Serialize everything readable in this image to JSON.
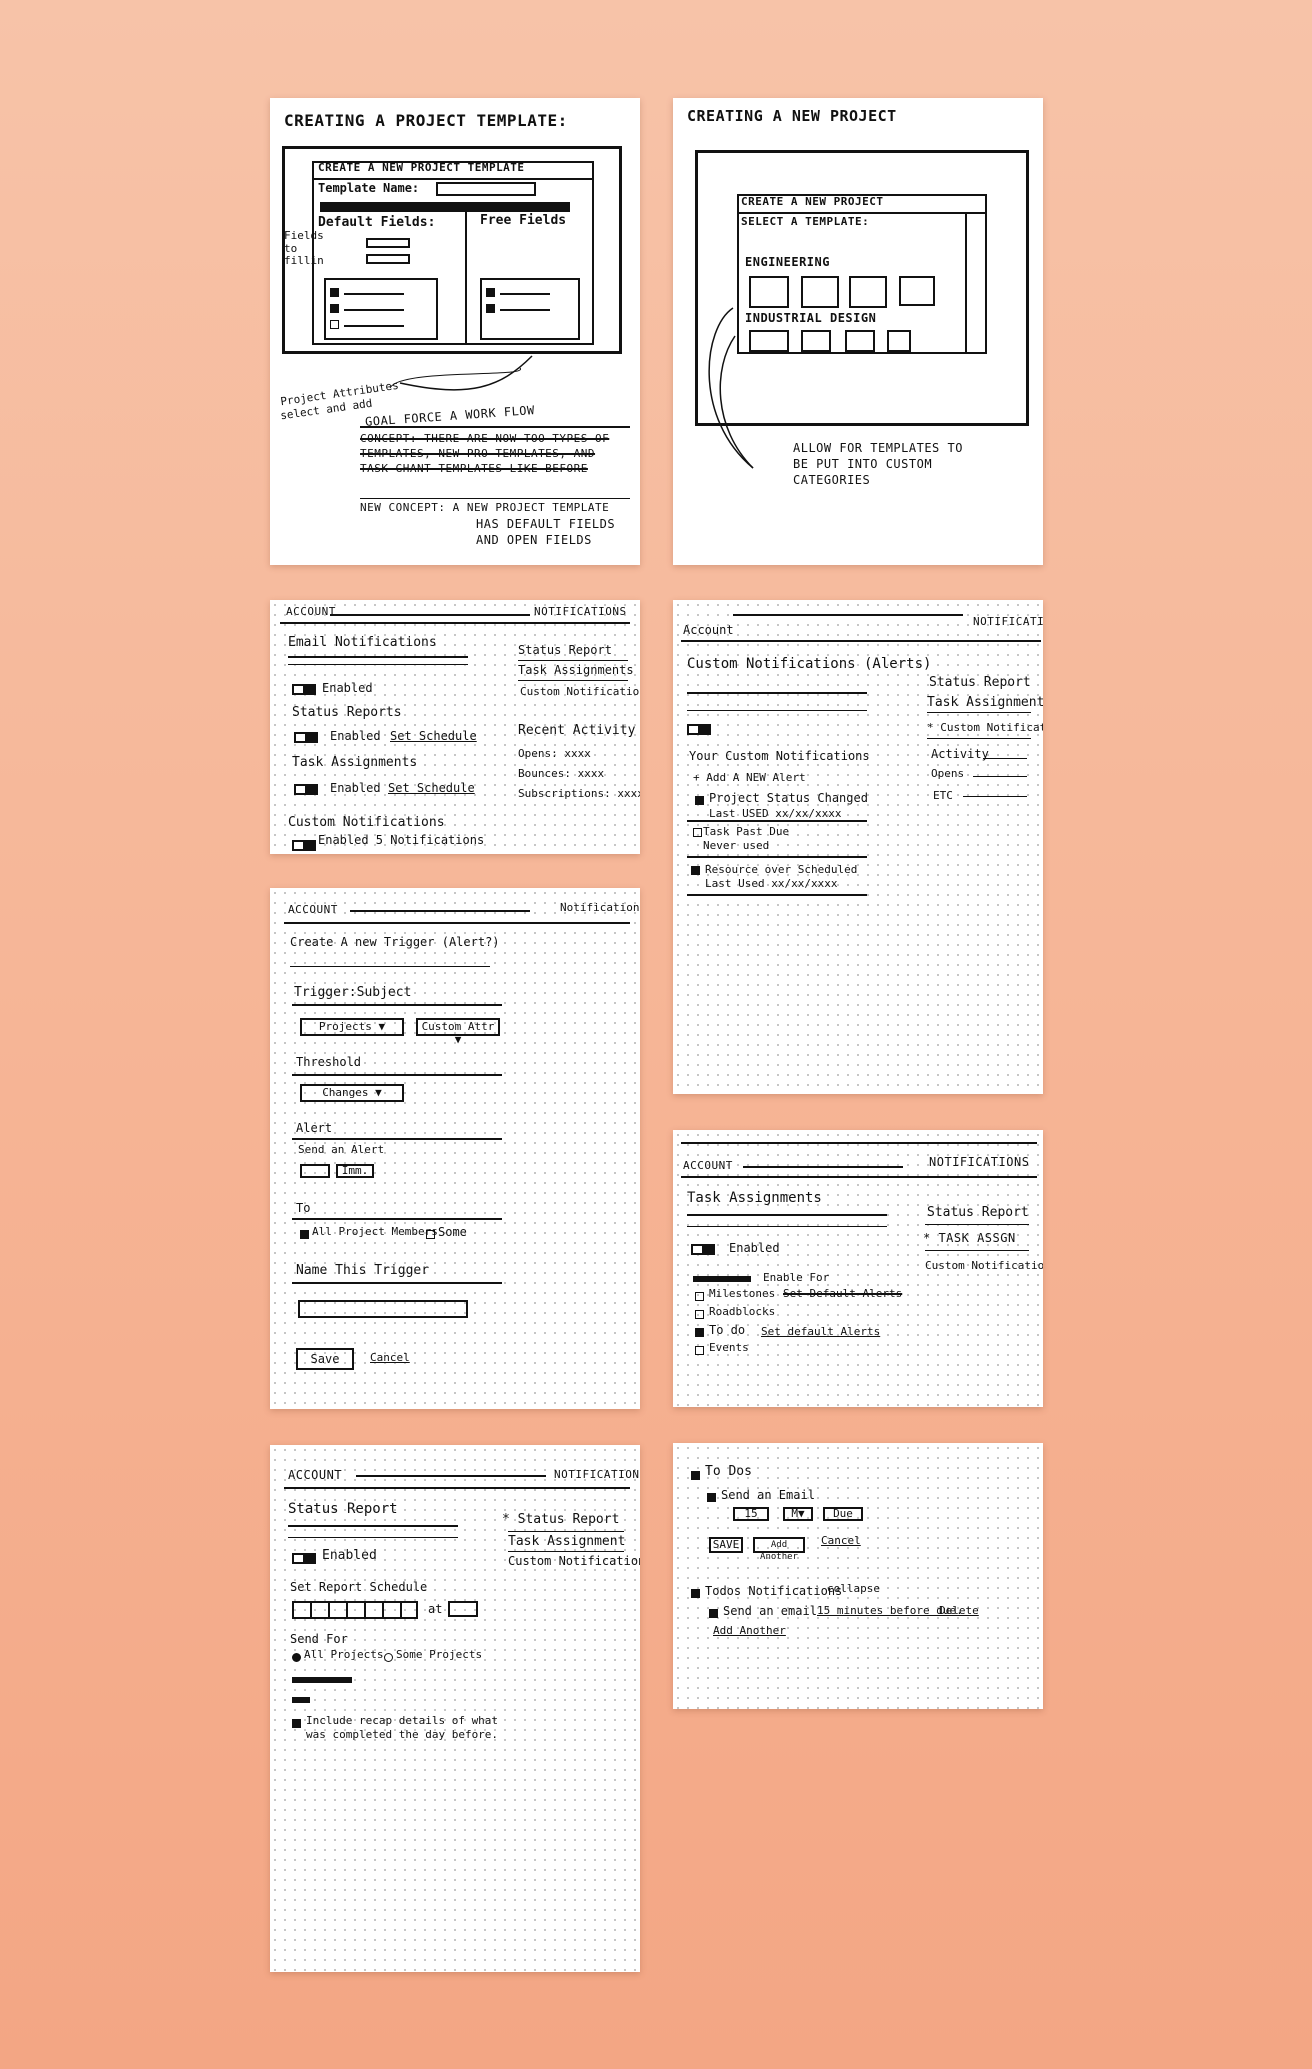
{
  "card1": {
    "title": "CREATING A PROJECT TEMPLATE:",
    "window_title": "CREATE A NEW PROJECT TEMPLATE",
    "template_name_label": "Template Name:",
    "default_fields": "Default Fields:",
    "free_fields": "Free Fields",
    "side_note": "Fields to fillin",
    "note_attributes": "Project Attributes",
    "note_select": "select and add",
    "goal": "GOAL FORCE A WORK FLOW",
    "struck": "CONCEPT: THERE ARE NOW TOO TYPES OF TEMPLATES, NEW PRO TEMPLATES, AND TASK GHANT TEMPLATES LIKE BEFORE",
    "new_concept_1": "NEW CONCEPT: A NEW PROJECT TEMPLATE",
    "new_concept_2": "HAS DEFAULT FIELDS",
    "new_concept_3": "AND OPEN FIELDS"
  },
  "card2": {
    "title": "CREATING A NEW PROJECT",
    "window_title": "CREATE A NEW PROJECT",
    "select_label": "SELECT A TEMPLATE:",
    "category_1": "ENGINEERING",
    "category_2": "INDUSTRIAL DESIGN",
    "note_1": "ALLOW FOR TEMPLATES TO",
    "note_2": "BE PUT INTO CUSTOM",
    "note_3": "CATEGORIES"
  },
  "card3": {
    "account": "ACCOUNT",
    "notifications": "NOTIFICATIONS",
    "email_notifications": "Email Notifications",
    "enabled": "Enabled",
    "status_reports": "Status Reports",
    "set_schedule": "Set Schedule",
    "task_assignments": "Task Assignments",
    "custom_notifications": "Custom Notifications",
    "enabled_5": "Enabled  5 Notifications",
    "nav": [
      "Status Report",
      "Task Assignments",
      "Custom Notification"
    ],
    "recent_activity": "Recent Activity",
    "opens": "Opens: xxxx",
    "bounces": "Bounces: xxxx",
    "subscriptions": "Subscriptions: xxxx"
  },
  "card4": {
    "account": "Account",
    "notifications": "NOTIFICATI",
    "title": "Custom Notifications (Alerts)",
    "subtitle": "(Alerts)",
    "your_custom": "Your Custom Notifications",
    "add": "+ Add A NEW Alert",
    "item1": "Project Status Changed",
    "item1_meta": "Last USED xx/xx/xxxx",
    "item2": "Task Past Due",
    "item2_meta": "Never used",
    "item3": "Resource over Scheduled",
    "item3_meta": "Last Used xx/xx/xxxx",
    "nav": [
      "Status Report",
      "Task Assignment",
      "* Custom Notification"
    ],
    "activity": "Activity",
    "opens": "Opens",
    "etc": "ETC"
  },
  "card5": {
    "account": "ACCOUNT",
    "notifications": "Notifications",
    "title": "Create A new Trigger (Alert?)",
    "trigger_subject": "Trigger:Subject",
    "projects": "Projects",
    "custom_attr": "Custom Attr",
    "threshold": "Threshold",
    "changes": "Changes",
    "alert": "Alert",
    "send_alert": "Send an Alert",
    "immed": "Imm.",
    "to": "To",
    "all_members": "All Project Members",
    "some": "Some",
    "name_trigger": "Name This Trigger",
    "save": "Save",
    "cancel": "Cancel"
  },
  "card6": {
    "account": "ACCOUNT",
    "notifications": "NOTIFICATIONS",
    "title": "Task Assignments",
    "enabled": "Enabled",
    "enable_for": "Enable For",
    "milestones": "Milestones",
    "set_default_alerts_struck": "Set Default Alerts",
    "roadblocks": "Roadblocks",
    "todo": "To do",
    "set_default_alerts": "Set default Alerts",
    "events": "Events",
    "nav": [
      "Status Report",
      "* TASK ASSGN",
      "Custom Notification"
    ]
  },
  "card7": {
    "account": "ACCOUNT",
    "notifications": "NOTIFICATIONS",
    "title": "Status Report",
    "enabled": "Enabled",
    "set_schedule": "Set Report Schedule",
    "at": "at",
    "send_for": "Send For",
    "all_projects": "All Projects",
    "some_projects": "Some Projects",
    "recap": "Include recap details of what",
    "recap2": "was completed the day before.",
    "nav": [
      "* Status Report",
      "Task Assignment",
      "Custom Notifications"
    ]
  },
  "card8": {
    "todos": "To Dos",
    "send_email": "Send an Email",
    "num": "15",
    "unit": "M",
    "due": "Due",
    "save": "SAVE",
    "add_another": "Add Another",
    "cancel": "Cancel",
    "todos_notifications": "Todos Notifications",
    "collapse": "collapse",
    "send_line": "Send an email",
    "before_due": "15 minutes before due.",
    "delete": "Delete",
    "add_another_link": "Add Another"
  }
}
